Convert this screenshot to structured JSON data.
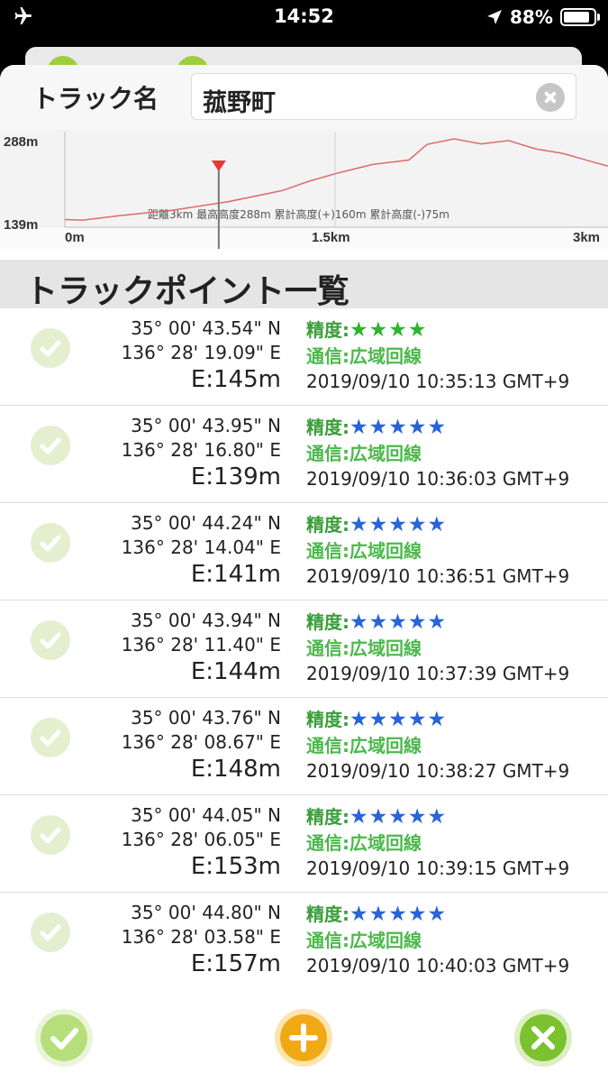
{
  "status_bar": {
    "time": "14:52",
    "battery_percent": "88%",
    "battery_level": 0.88
  },
  "track_name": {
    "label": "トラック名",
    "value": "菰野町"
  },
  "chart_data": {
    "type": "line",
    "title": "",
    "xlabel": "",
    "ylabel": "",
    "x_unit": "km",
    "y_unit": "m",
    "x_ticks": [
      "0m",
      "1.5km",
      "3km"
    ],
    "y_ticks": [
      "288m",
      "139m"
    ],
    "xlim": [
      0,
      3
    ],
    "ylim": [
      139,
      288
    ],
    "series": [
      {
        "x": [
          0,
          0.1,
          0.3,
          0.6,
          0.9,
          1.2,
          1.35,
          1.5,
          1.7,
          1.9,
          2.0,
          2.15,
          2.3,
          2.45,
          2.6,
          2.75,
          2.9,
          3.0
        ],
        "y": [
          143,
          142,
          150,
          160,
          175,
          195,
          212,
          226,
          242,
          250,
          278,
          288,
          279,
          285,
          270,
          262,
          248,
          239
        ]
      }
    ],
    "marker_x": 0.85,
    "summary": "距離3km 最高高度288m 累計高度(+)160m 累計高度(-)75m",
    "line_color": "#e06a6a",
    "marker_color": "#e53935"
  },
  "list": {
    "title": "トラックポイント一覧",
    "accuracy_label": "精度:",
    "comm_label": "通信:広域回線",
    "items": [
      {
        "lat": "35° 00' 43.54\" N",
        "lon": "136° 28' 19.09\" E",
        "elev": "E:145m",
        "stars": "★★★★",
        "star_color": "#2db52d",
        "time": "2019/09/10 10:35:13 GMT+9"
      },
      {
        "lat": "35° 00' 43.95\" N",
        "lon": "136° 28' 16.80\" E",
        "elev": "E:139m",
        "stars": "★★★★★",
        "star_color": "#2864d8",
        "time": "2019/09/10 10:36:03 GMT+9"
      },
      {
        "lat": "35° 00' 44.24\" N",
        "lon": "136° 28' 14.04\" E",
        "elev": "E:141m",
        "stars": "★★★★★",
        "star_color": "#2864d8",
        "time": "2019/09/10 10:36:51 GMT+9"
      },
      {
        "lat": "35° 00' 43.94\" N",
        "lon": "136° 28' 11.40\" E",
        "elev": "E:144m",
        "stars": "★★★★★",
        "star_color": "#2864d8",
        "time": "2019/09/10 10:37:39 GMT+9"
      },
      {
        "lat": "35° 00' 43.76\" N",
        "lon": "136° 28' 08.67\" E",
        "elev": "E:148m",
        "stars": "★★★★★",
        "star_color": "#2864d8",
        "time": "2019/09/10 10:38:27 GMT+9"
      },
      {
        "lat": "35° 00' 44.05\" N",
        "lon": "136° 28' 06.05\" E",
        "elev": "E:153m",
        "stars": "★★★★★",
        "star_color": "#2864d8",
        "time": "2019/09/10 10:39:15 GMT+9"
      },
      {
        "lat": "35° 00' 44.80\" N",
        "lon": "136° 28' 03.58\" E",
        "elev": "E:157m",
        "stars": "★★★★★",
        "star_color": "#2864d8",
        "time": "2019/09/10 10:40:03 GMT+9"
      }
    ]
  },
  "colors": {
    "accuracy_label": "#3a9e3a",
    "comm": "#4cb84c",
    "confirm": "#b6df7b",
    "add": "#f0a915",
    "close": "#7cc22f"
  },
  "icons": {
    "airplane": "airplane-icon",
    "location": "location-arrow-icon",
    "battery": "battery-icon",
    "clear": "clear-icon",
    "row_check": "check-circle-icon",
    "confirm": "check-icon",
    "add": "plus-icon",
    "close": "close-icon"
  }
}
